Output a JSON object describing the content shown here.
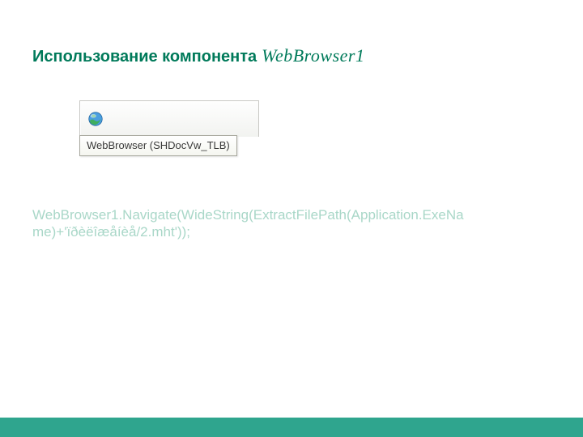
{
  "title": {
    "prefix": "Использование компонента",
    "script": "WebBrowser1"
  },
  "screenshot": {
    "icon": "globe-icon",
    "tooltip": "WebBrowser (SHDocVw_TLB)"
  },
  "code": "WebBrowser1.Navigate(WideString(ExtractFilePath(Application.ExeName)+'ïðèëîæåíèå/2.mht'));",
  "colors": {
    "accent": "#007a5a",
    "footer": "#2fa58e",
    "faded": "#a9d7c8"
  }
}
